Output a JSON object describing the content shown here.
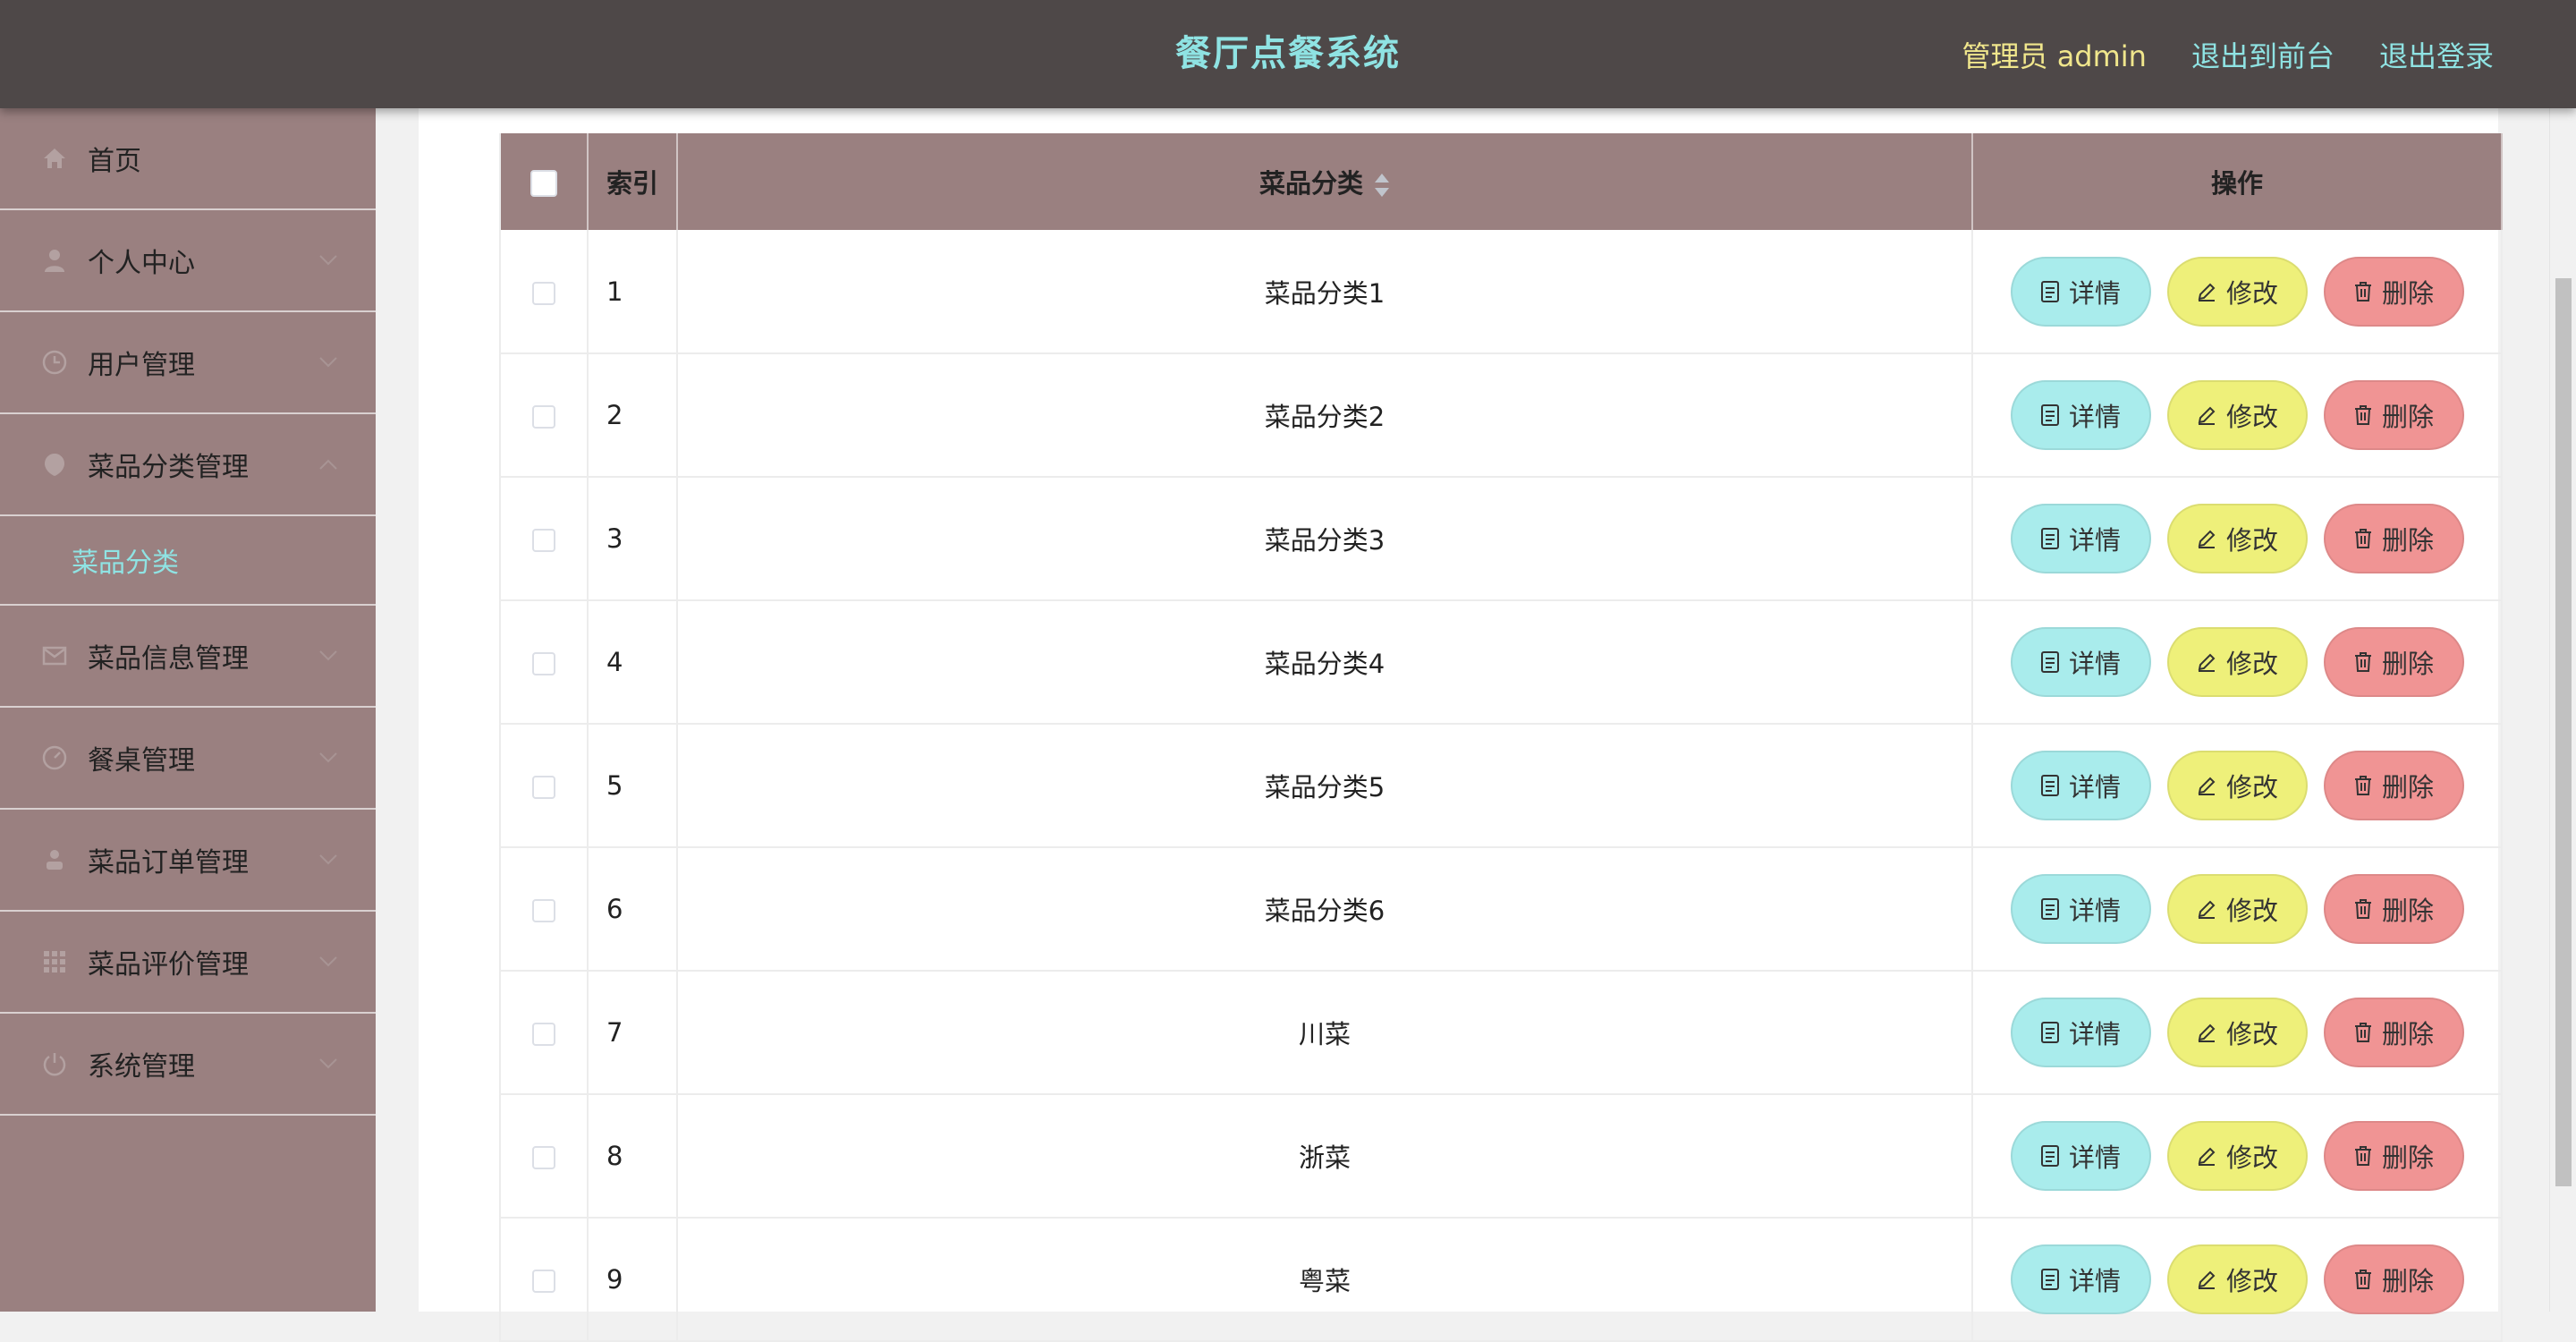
{
  "header": {
    "title": "餐厅点餐系统",
    "admin_label": "管理员 admin",
    "link_frontend": "退出到前台",
    "link_logout": "退出登录"
  },
  "sidebar": {
    "items": [
      {
        "label": "首页",
        "icon": "home-icon"
      },
      {
        "label": "个人中心",
        "icon": "user-icon"
      },
      {
        "label": "用户管理",
        "icon": "clock-icon"
      },
      {
        "label": "菜品分类管理",
        "icon": "shield-icon"
      },
      {
        "label": "菜品信息管理",
        "icon": "mail-icon"
      },
      {
        "label": "餐桌管理",
        "icon": "gauge-icon"
      },
      {
        "label": "菜品订单管理",
        "icon": "person-icon"
      },
      {
        "label": "菜品评价管理",
        "icon": "grid-icon"
      },
      {
        "label": "系统管理",
        "icon": "power-icon"
      }
    ],
    "active_sub": "菜品分类"
  },
  "table": {
    "headers": {
      "index": "索引",
      "name": "菜品分类",
      "ops": "操作"
    },
    "buttons": {
      "detail": "详情",
      "edit": "修改",
      "delete": "删除"
    },
    "rows": [
      {
        "index": "1",
        "name": "菜品分类1"
      },
      {
        "index": "2",
        "name": "菜品分类2"
      },
      {
        "index": "3",
        "name": "菜品分类3"
      },
      {
        "index": "4",
        "name": "菜品分类4"
      },
      {
        "index": "5",
        "name": "菜品分类5"
      },
      {
        "index": "6",
        "name": "菜品分类6"
      },
      {
        "index": "7",
        "name": "川菜"
      },
      {
        "index": "8",
        "name": "浙菜"
      },
      {
        "index": "9",
        "name": "粤菜"
      }
    ]
  },
  "colors": {
    "header_bg": "#4e4848",
    "title": "#8fe3e3",
    "admin": "#f0e68c",
    "sidebar_bg": "#9a8080",
    "btn_detail": "#a9ecec",
    "btn_edit": "#eef07a",
    "btn_delete": "#f09494"
  }
}
